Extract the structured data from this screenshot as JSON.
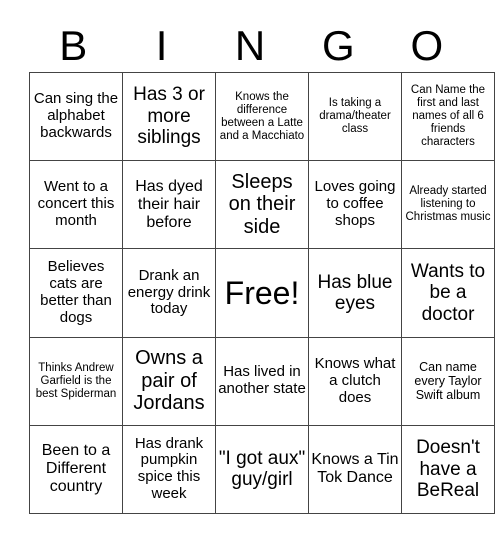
{
  "title_letters": [
    "B",
    "I",
    "N",
    "G",
    "O"
  ],
  "rows": [
    [
      "Can sing the alphabet backwards",
      "Has 3 or more siblings",
      "Knows the difference between a Latte and a Macchiato",
      "Is taking a drama/theater class",
      "Can Name the first and last names of all 6 friends characters"
    ],
    [
      "Went to a concert this month",
      "Has dyed their hair before",
      "Sleeps on their side",
      "Loves going to coffee shops",
      "Already started listening to Christmas music"
    ],
    [
      "Believes cats are better than dogs",
      "Drank an energy drink today",
      "Free!",
      "Has blue eyes",
      "Wants to be a doctor"
    ],
    [
      "Thinks Andrew Garfield is the best Spiderman",
      "Owns a pair of Jordans",
      "Has lived in another state",
      "Knows what a clutch does",
      "Can name every Taylor Swift album"
    ],
    [
      "Been to a Different country",
      "Has drank pumpkin spice this week",
      "\"I got aux\" guy/girl",
      "Knows a Tin Tok Dance",
      "Doesn't have a BeReal"
    ]
  ]
}
